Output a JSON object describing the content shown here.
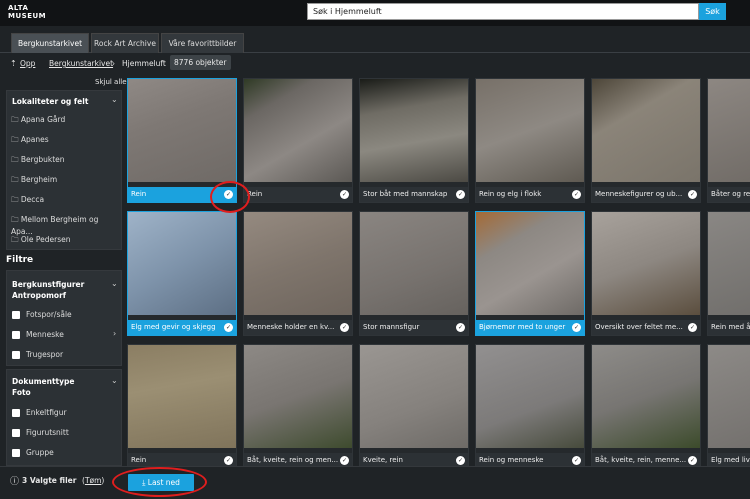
{
  "logo": {
    "line1": "ALTA",
    "line2": "MUSEUM"
  },
  "search": {
    "value": "Søk i Hjemmeluft",
    "button": "Søk"
  },
  "tabs": [
    "Bergkunstarkivet",
    "Rock Art Archive",
    "Våre favorittbilder"
  ],
  "breadcrumb": {
    "up": "Opp",
    "parent": "Bergkunstarkivet",
    "current": "Hjemmeluft",
    "count": "8776 objekter"
  },
  "sidebar": {
    "hide_all": "Skjul alle",
    "locations_title": "Lokaliteter og felt",
    "locations": [
      "Apana Gård",
      "Apanes",
      "Bergbukten",
      "Bergheim",
      "Decca",
      "Mellom Bergheim og Apa...",
      "Ole Pedersen"
    ],
    "filters_title": "Filtre",
    "group1_title": "Bergkunstfigurer",
    "group1_sub": "Antropomorf",
    "group1_items": [
      "Fotspor/såle",
      "Menneske",
      "Trugespor"
    ],
    "group2_title": "Dokumenttype",
    "group2_sub": "Foto",
    "group2_items": [
      "Enkeltfigur",
      "Figurutsnitt",
      "Gruppe"
    ]
  },
  "cards": [
    {
      "caption": "Rein",
      "selected": true
    },
    {
      "caption": "Rein",
      "selected": false
    },
    {
      "caption": "Stor båt med mannskap",
      "selected": false
    },
    {
      "caption": "Rein og elg i flokk",
      "selected": false
    },
    {
      "caption": "Menneskefigurer og ub...",
      "selected": false
    },
    {
      "caption": "Båter og rein",
      "selected": false
    },
    {
      "caption": "Elg med gevir og skjegg",
      "selected": true
    },
    {
      "caption": "Menneske holder en kv...",
      "selected": false
    },
    {
      "caption": "Stor mannsfigur",
      "selected": false
    },
    {
      "caption": "Bjørnemor med to unger",
      "selected": true
    },
    {
      "caption": "Oversikt over feltet me...",
      "selected": false
    },
    {
      "caption": "Rein med åpen",
      "selected": false
    },
    {
      "caption": "Rein",
      "selected": false
    },
    {
      "caption": "Båt, kveite, rein og men...",
      "selected": false
    },
    {
      "caption": "Kveite, rein",
      "selected": false
    },
    {
      "caption": "Rein og menneske",
      "selected": false
    },
    {
      "caption": "Båt, kveite, rein, menne...",
      "selected": false
    },
    {
      "caption": "Elg med livsl",
      "selected": false
    }
  ],
  "footer": {
    "selected_text": "3 Valgte filer",
    "clear": "Tøm",
    "download": "Last ned"
  },
  "colors": {
    "accent": "#1ba2de",
    "annotation": "#e01e1e"
  }
}
